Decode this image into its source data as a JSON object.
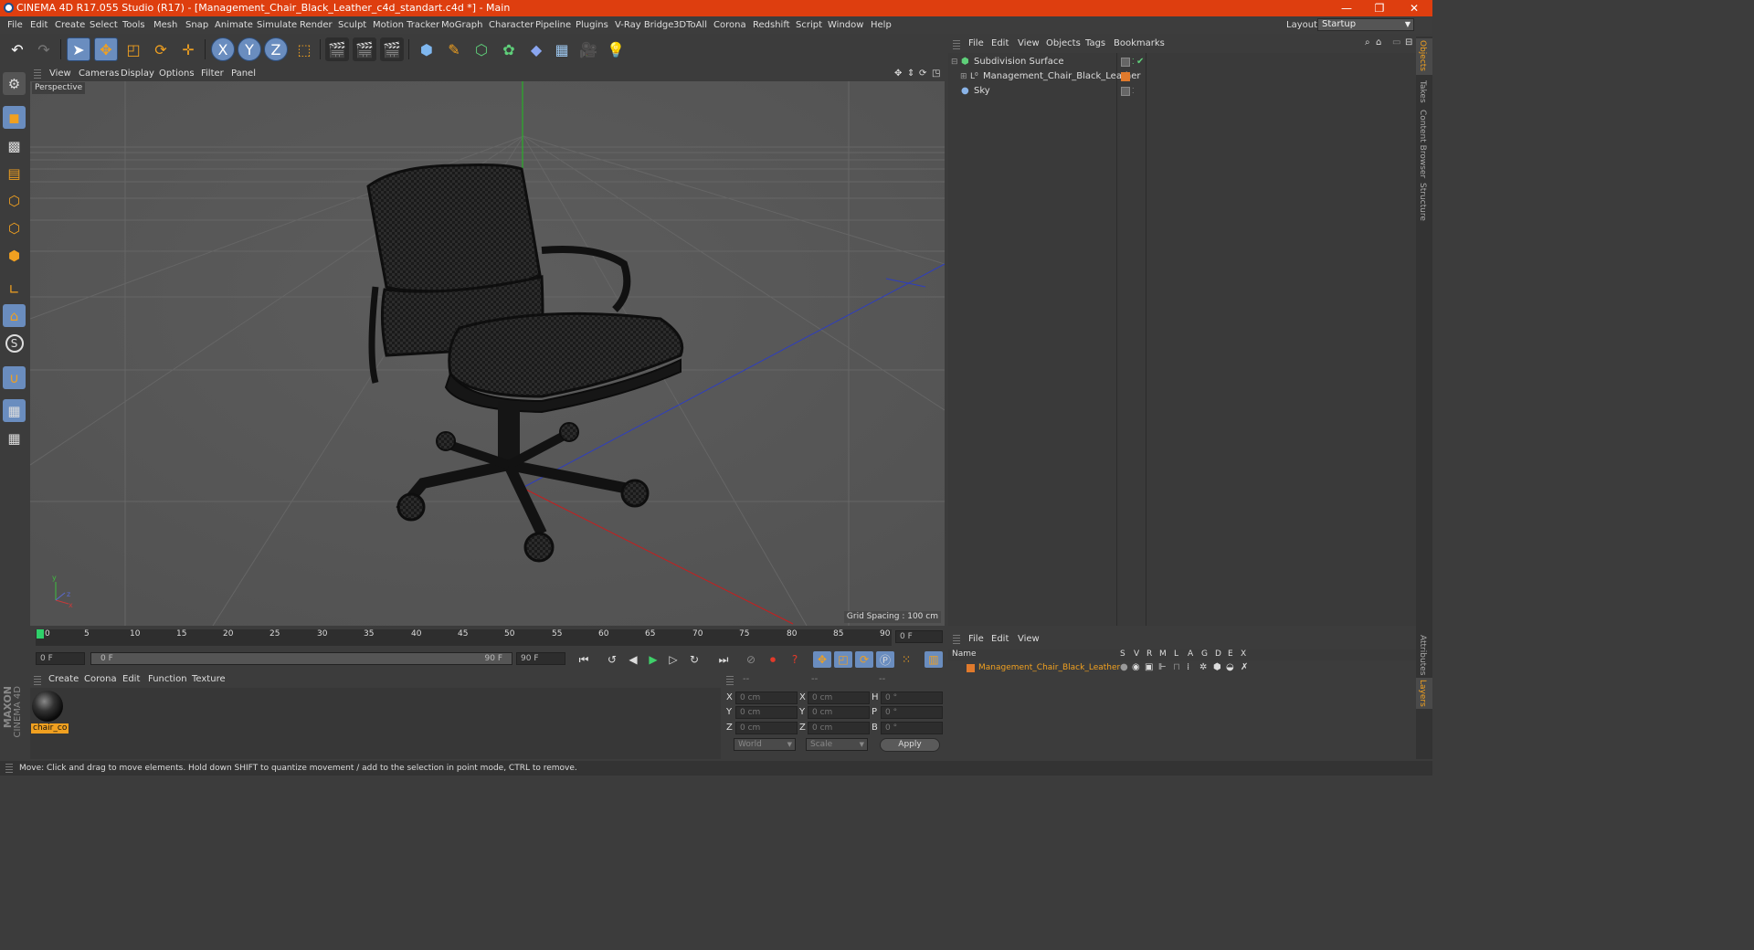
{
  "title": "CINEMA 4D R17.055 Studio (R17) - [Management_Chair_Black_Leather_c4d_standart.c4d *] - Main",
  "window_controls": [
    "—",
    "❐",
    "✕"
  ],
  "menu": [
    "File",
    "Edit",
    "Create",
    "Select",
    "Tools",
    "Mesh",
    "Snap",
    "Animate",
    "Simulate",
    "Render",
    "Sculpt",
    "Motion Tracker",
    "MoGraph",
    "Character",
    "Pipeline",
    "Plugins",
    "V-Ray Bridge",
    "3DToAll",
    "Corona",
    "Redshift",
    "Script",
    "Window",
    "Help"
  ],
  "layout": {
    "label": "Layout:",
    "value": "Startup"
  },
  "toolbar": {
    "undo_icon": "undo-icon",
    "redo_icon": "redo-icon",
    "axis_x": "X",
    "axis_y": "Y",
    "axis_z": "Z"
  },
  "viewport": {
    "menu": [
      "View",
      "Cameras",
      "Display",
      "Options",
      "Filter",
      "Panel"
    ],
    "label": "Perspective",
    "grid_spacing": "Grid Spacing : 100 cm"
  },
  "timeline": {
    "ticks": [
      "0",
      "5",
      "10",
      "15",
      "20",
      "25",
      "30",
      "35",
      "40",
      "45",
      "50",
      "55",
      "60",
      "65",
      "70",
      "75",
      "80",
      "85",
      "90"
    ],
    "current_frame": "0 F",
    "start": "0 F",
    "range_start": "0 F",
    "range_end": "90 F",
    "end": "90 F"
  },
  "material_manager": {
    "menu": [
      "Create",
      "Corona",
      "Edit",
      "Function",
      "Texture"
    ],
    "material_name": "chair_co"
  },
  "coordinates": {
    "headers": [
      "--",
      "--",
      "--"
    ],
    "rows": [
      {
        "a": "X",
        "av": "0 cm",
        "b": "X",
        "bv": "0 cm",
        "c": "H",
        "cv": "0 °"
      },
      {
        "a": "Y",
        "av": "0 cm",
        "b": "Y",
        "bv": "0 cm",
        "c": "P",
        "cv": "0 °"
      },
      {
        "a": "Z",
        "av": "0 cm",
        "b": "Z",
        "bv": "0 cm",
        "c": "B",
        "cv": "0 °"
      }
    ],
    "mode1": "World",
    "mode2": "Scale",
    "apply": "Apply"
  },
  "object_manager": {
    "menu": [
      "File",
      "Edit",
      "View",
      "Objects",
      "Tags",
      "Bookmarks"
    ],
    "objects": [
      "Subdivision Surface",
      "Management_Chair_Black_Leather",
      "Sky"
    ]
  },
  "attributes": {
    "menu": [
      "File",
      "Edit",
      "View"
    ],
    "columns": [
      "Name",
      "S",
      "V",
      "R",
      "M",
      "L",
      "A",
      "G",
      "D",
      "E",
      "X"
    ],
    "layer": "Management_Chair_Black_Leather"
  },
  "right_tabs": [
    "Objects",
    "Takes",
    "Content Browser",
    "Structure",
    "Attributes",
    "Layers"
  ],
  "brand": [
    "MAXON",
    "CINEMA 4D"
  ],
  "status": "Move: Click and drag to move elements. Hold down SHIFT to quantize movement / add to the selection in point mode, CTRL to remove.",
  "colors": {
    "titlebar": "#de3e0f",
    "selected": "#6a8dbf",
    "layer": "#e07a2c",
    "highlight": "#f0a020"
  }
}
